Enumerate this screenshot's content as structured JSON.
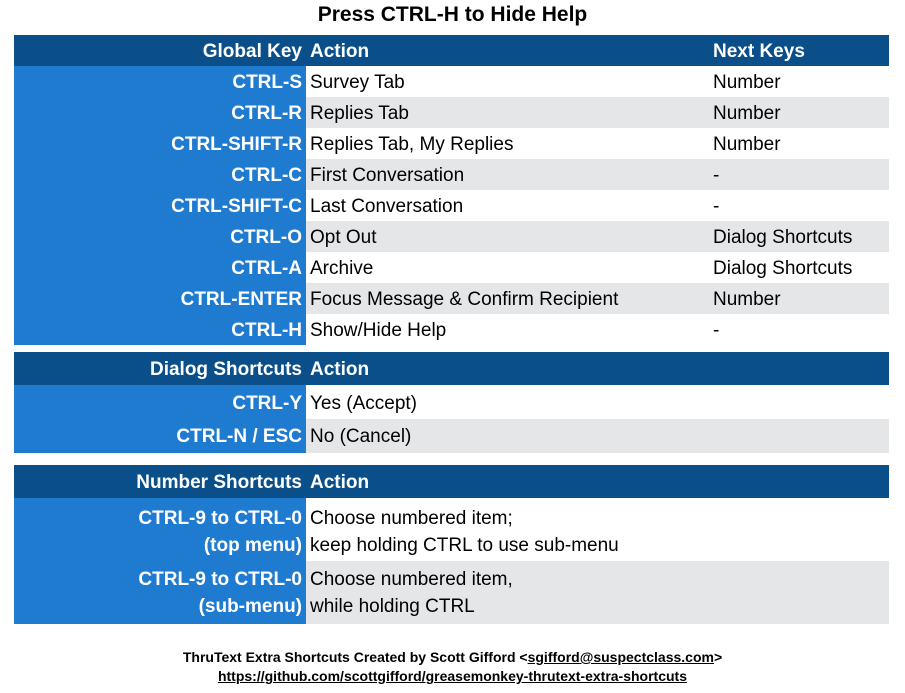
{
  "title": "Press CTRL-H to Hide Help",
  "global": {
    "header": {
      "key": "Global Key",
      "action": "Action",
      "next": "Next Keys"
    },
    "rows": [
      {
        "key": "CTRL-S",
        "action": "Survey Tab",
        "next": "Number"
      },
      {
        "key": "CTRL-R",
        "action": "Replies Tab",
        "next": "Number"
      },
      {
        "key": "CTRL-SHIFT-R",
        "action": "Replies Tab, My Replies",
        "next": "Number"
      },
      {
        "key": "CTRL-C",
        "action": "First Conversation",
        "next": "-"
      },
      {
        "key": "CTRL-SHIFT-C",
        "action": "Last Conversation",
        "next": "-"
      },
      {
        "key": "CTRL-O",
        "action": "Opt Out",
        "next": "Dialog Shortcuts"
      },
      {
        "key": "CTRL-A",
        "action": "Archive",
        "next": "Dialog Shortcuts"
      },
      {
        "key": "CTRL-ENTER",
        "action": "Focus Message & Confirm Recipient",
        "next": "Number"
      },
      {
        "key": "CTRL-H",
        "action": "Show/Hide Help",
        "next": "-"
      }
    ]
  },
  "dialog": {
    "header": {
      "key": "Dialog Shortcuts",
      "action": "Action"
    },
    "rows": [
      {
        "key": "CTRL-Y",
        "action": "Yes (Accept)"
      },
      {
        "key": "CTRL-N / ESC",
        "action": "No (Cancel)"
      }
    ]
  },
  "number": {
    "header": {
      "key": "Number Shortcuts",
      "action": "Action"
    },
    "rows": [
      {
        "key": "CTRL-9 to CTRL-0\n(top menu)",
        "action": "Choose numbered item;\nkeep holding CTRL to use sub-menu"
      },
      {
        "key": "CTRL-9 to CTRL-0\n(sub-menu)",
        "action": "Choose numbered item,\nwhile holding CTRL"
      }
    ]
  },
  "footer": {
    "credit": "ThruText Extra Shortcuts Created by Scott Gifford <",
    "email": "sgifford@suspectclass.com",
    "credit_end": ">",
    "url": "https://github.com/scottgifford/greasemonkey-thrutext-extra-shortcuts"
  }
}
